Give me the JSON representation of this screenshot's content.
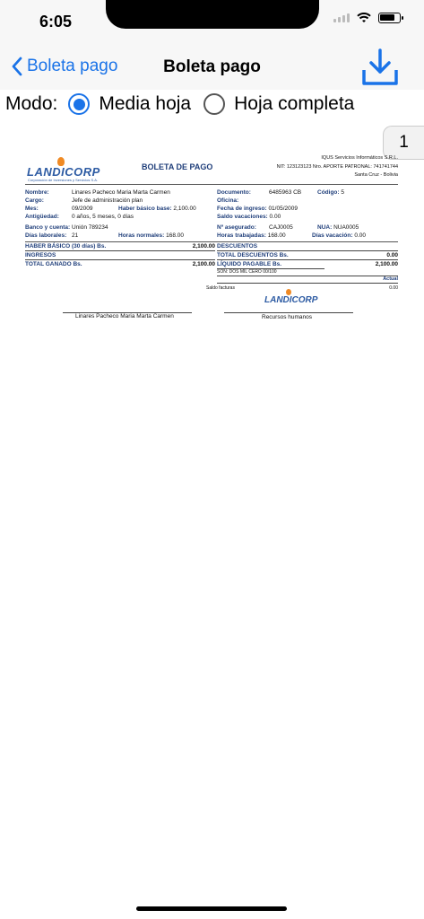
{
  "status_bar": {
    "time": "6:05",
    "battery_level": 0.8
  },
  "nav": {
    "back_label": "Boleta pago",
    "title": "Boleta pago",
    "download_icon": "download-icon"
  },
  "mode": {
    "prefix": "Modo:",
    "options": [
      "Media hoja",
      "Hoja completa"
    ],
    "selected": "Media hoja"
  },
  "page_indicator": "1",
  "document": {
    "logo": "LANDICORP",
    "logo_sub": "Corporación de Inversiones y Servicios S.A.",
    "title": "BOLETA DE PAGO",
    "company_lines": [
      "IQUS Servicios Informáticos S.R.L.",
      "NIT: 123123123  Nro. APORTE PATRONAL: 741741744",
      "Santa Cruz - Bolivia"
    ],
    "left_fields": [
      {
        "label": "Nombre:",
        "value": "Linares Pacheco Maria Marta Carmen"
      },
      {
        "label": "Cargo:",
        "value": "Jefe de administración plan"
      },
      {
        "label": "Mes:",
        "value": "09/2009"
      },
      {
        "label": "Antigüedad:",
        "value": "0 años, 5 meses, 0 días"
      },
      {
        "label": "Banco y cuenta:",
        "value": "Unión 789234"
      },
      {
        "label": "Días laborales:",
        "value": "21"
      }
    ],
    "haber_basico_base": {
      "label": "Haber básico base:",
      "value": "2,100.00"
    },
    "horas_normales": {
      "label": "Horas normales:",
      "value": "168.00"
    },
    "right_fields": [
      {
        "label": "Documento:",
        "value": "6485963 CB"
      },
      {
        "label": "Oficina:",
        "value": ""
      },
      {
        "label": "Fecha de ingreso:",
        "value": "01/05/2009"
      },
      {
        "label": "Saldo vacaciones:",
        "value": "0.00"
      },
      {
        "label": "Nº asegurado:",
        "value": "CAJ0005"
      },
      {
        "label": "Horas trabajadas:",
        "value": "168.00"
      }
    ],
    "codigo": {
      "label": "Código:",
      "value": "5"
    },
    "nua": {
      "label": "NUA:",
      "value": "NUA0005"
    },
    "dias_vacacion": {
      "label": "Días vacación:",
      "value": "0.00"
    },
    "haber_basico_dias": {
      "label": "HABER BÁSICO (30 días) Bs.",
      "value": "2,100.00"
    },
    "ingresos": "INGRESOS",
    "total_ganado": {
      "label": "TOTAL GANADO Bs.",
      "value": "2,100.00"
    },
    "descuentos": "DESCUENTOS",
    "total_descuentos": {
      "label": "TOTAL DESCUENTOS Bs.",
      "value": "0.00"
    },
    "liquido_pagable": {
      "label": "LÍQUIDO PAGABLE Bs.",
      "value": "2,100.00"
    },
    "son": "SON: DOS MIL CERO 00/100",
    "actual_label": "Actual",
    "saldo_facturas": {
      "label": "Saldo facturas",
      "value": "0.00"
    },
    "signature_left": "Linares Pacheco Maria Marta Carmen",
    "signature_right": "Recursos humanos",
    "logo_small": "LANDICORP"
  }
}
